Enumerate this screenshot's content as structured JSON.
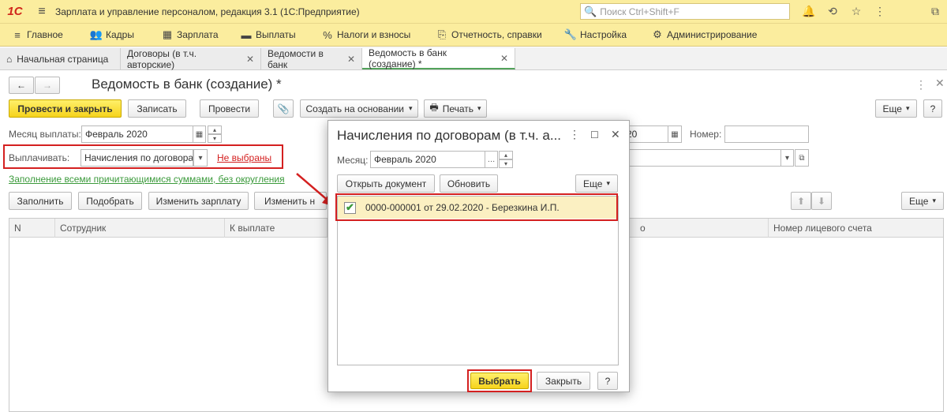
{
  "app": {
    "logo": "1С",
    "title": "Зарплата и управление персоналом, редакция 3.1  (1С:Предприятие)",
    "search_placeholder": "Поиск Ctrl+Shift+F"
  },
  "sections": [
    {
      "icon": "≡",
      "label": "Главное"
    },
    {
      "icon": "👥",
      "label": "Кадры"
    },
    {
      "icon": "▦",
      "label": "Зарплата"
    },
    {
      "icon": "▬",
      "label": "Выплаты"
    },
    {
      "icon": "%",
      "label": "Налоги и взносы"
    },
    {
      "icon": "⎘",
      "label": "Отчетность, справки"
    },
    {
      "icon": "🔧",
      "label": "Настройка"
    },
    {
      "icon": "⚙",
      "label": "Администрирование"
    }
  ],
  "tabs": [
    {
      "label": "Начальная страница"
    },
    {
      "label": "Договоры (в т.ч. авторские)"
    },
    {
      "label": "Ведомости в банк"
    },
    {
      "label": "Ведомость в банк (создание) *"
    }
  ],
  "form": {
    "title": "Ведомость в банк (создание) *",
    "post_close": "Провести и закрыть",
    "save": "Записать",
    "post": "Провести",
    "create_based": "Создать на основании",
    "print": "Печать",
    "more": "Еще",
    "month_label": "Месяц выплаты:",
    "month_value": "Февраль 2020",
    "number_label": "Номер:",
    "number_value": "",
    "date_partial": "20",
    "pay_label": "Выплачивать:",
    "pay_value": "Начисления по договорам",
    "not_selected": "Не выбраны",
    "fill_link": "Заполнение всеми причитающимися суммами, без округления",
    "fill": "Заполнить",
    "pick": "Подобрать",
    "change_salary": "Изменить зарплату",
    "change_partial": "Изменить н",
    "more2": "Еще"
  },
  "grid": {
    "columns": [
      "N",
      "Сотрудник",
      "К выплате",
      "о",
      "Номер лицевого счета"
    ]
  },
  "modal": {
    "title": "Начисления по договорам (в т.ч. а...",
    "month_label": "Месяц:",
    "month_value": "Февраль 2020",
    "open_doc": "Открыть документ",
    "refresh": "Обновить",
    "more": "Еще",
    "rows": [
      {
        "checked": true,
        "text": "0000-000001 от 29.02.2020 - Березкина И.П."
      }
    ],
    "select": "Выбрать",
    "close": "Закрыть",
    "help": "?"
  },
  "colors": {
    "accent_yellow": "#fbed9e",
    "highlight_red": "#d42020",
    "link_green": "#3b9a3b"
  }
}
